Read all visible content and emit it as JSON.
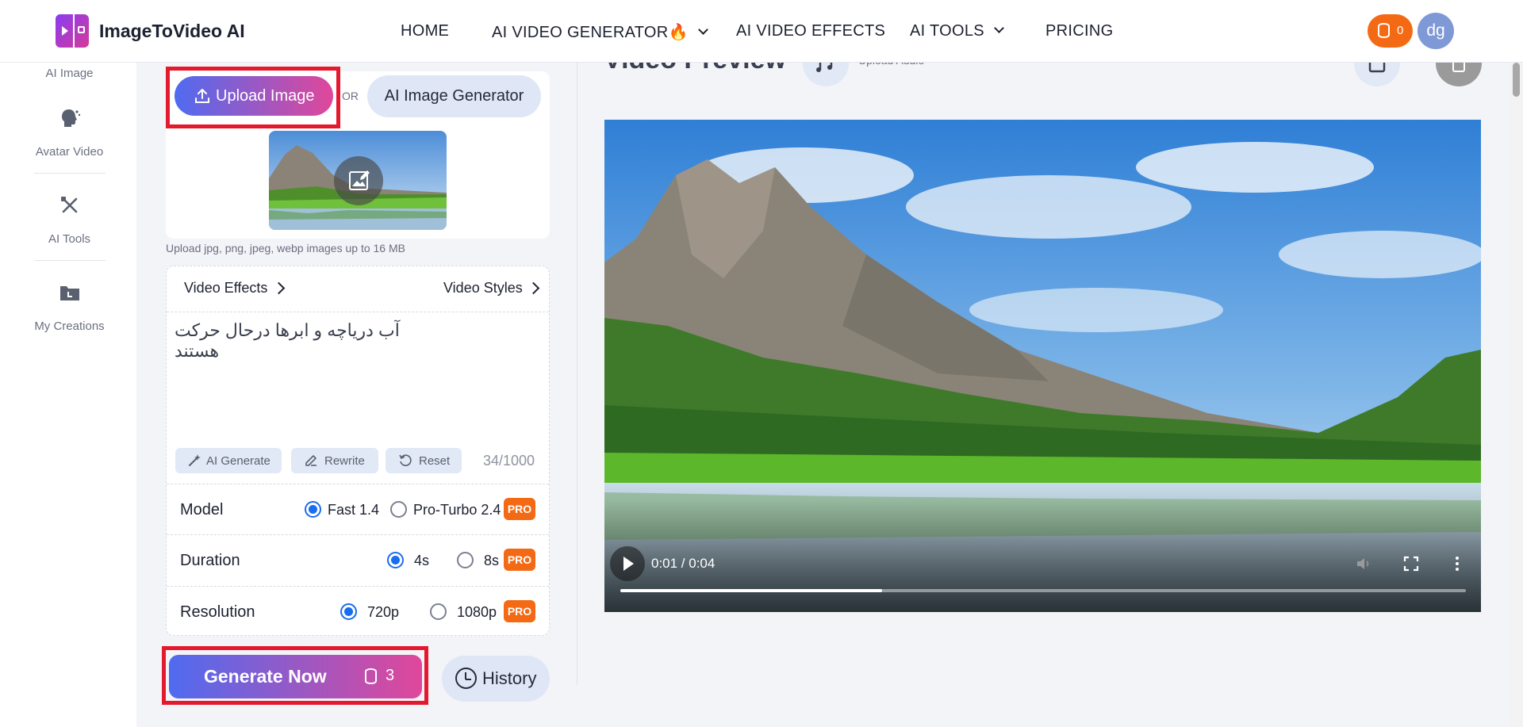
{
  "header": {
    "brand": "ImageToVideo AI",
    "nav": [
      {
        "label": "HOME"
      },
      {
        "label": "AI VIDEO GENERATOR🔥"
      },
      {
        "label": "AI VIDEO EFFECTS"
      },
      {
        "label": "AI TOOLS"
      },
      {
        "label": "PRICING"
      }
    ],
    "credits": "0",
    "avatar_initials": "dg"
  },
  "sidebar": {
    "items": [
      {
        "label": "AI Image",
        "icon": "image-icon"
      },
      {
        "label": "Avatar Video",
        "icon": "avatar-head-icon"
      },
      {
        "label": "AI Tools",
        "icon": "tools-icon"
      },
      {
        "label": "My Creations",
        "icon": "folder-icon"
      }
    ]
  },
  "upload": {
    "button_label": "Upload Image",
    "or_text": "OR",
    "ai_generator_label": "AI Image Generator",
    "hint": "Upload jpg, png, jpeg, webp images up to 16 MB"
  },
  "form": {
    "tabs": {
      "effects": "Video Effects",
      "styles": "Video Styles"
    },
    "prompt": "آب دریاچه و ابرها درحال حرکت هستند",
    "tools": {
      "ai_generate": "AI Generate",
      "rewrite": "Rewrite",
      "reset": "Reset"
    },
    "counter": "34/1000",
    "model": {
      "label": "Model",
      "options": [
        {
          "label": "Fast 1.4",
          "selected": true
        },
        {
          "label": "Pro-Turbo 2.4",
          "selected": false,
          "pro": "PRO"
        }
      ]
    },
    "duration": {
      "label": "Duration",
      "options": [
        {
          "label": "4s",
          "selected": true
        },
        {
          "label": "8s",
          "selected": false,
          "pro": "PRO"
        }
      ]
    },
    "resolution": {
      "label": "Resolution",
      "options": [
        {
          "label": "720p",
          "selected": true
        },
        {
          "label": "1080p",
          "selected": false,
          "pro": "PRO"
        }
      ]
    }
  },
  "actions": {
    "generate_label": "Generate Now",
    "generate_cost": "3",
    "history_label": "History"
  },
  "preview": {
    "title": "Video Preview",
    "audio_label": "Upload Audio",
    "time": "0:01 / 0:04",
    "progress": 0.31
  },
  "colors": {
    "accent_orange": "#f46a14",
    "gradient_start": "#4f6bf0",
    "gradient_end": "#e0479a",
    "highlight_red": "#e5192e",
    "radio_blue": "#1a6cf0"
  }
}
